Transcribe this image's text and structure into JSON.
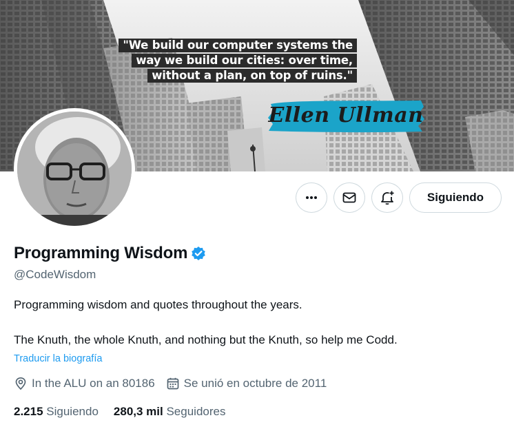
{
  "banner": {
    "quote_lines": [
      "\"We build our computer systems the",
      "way we build our cities: over time,",
      "without a plan, on top of ruins.\""
    ],
    "author": "Ellen Ullman",
    "accent_color": "#1ba4c9"
  },
  "actions": {
    "more_icon": "ellipsis-icon",
    "message_icon": "envelope-icon",
    "notify_icon": "bell-plus-icon",
    "follow_label": "Siguiendo"
  },
  "profile": {
    "display_name": "Programming Wisdom",
    "verified_icon": "verified-badge-icon",
    "verified_color": "#1d9bf0",
    "handle": "@CodeWisdom",
    "bio_line1": "Programming wisdom and quotes throughout the years.",
    "bio_line2": "The Knuth, the whole Knuth, and nothing but the Knuth, so help me Codd.",
    "translate_label": "Traducir la biografía",
    "location": "In the ALU on an 80186",
    "joined": "Se unió en octubre de 2011"
  },
  "stats": {
    "following_count": "2.215",
    "following_label": "Siguiendo",
    "followers_count": "280,3 mil",
    "followers_label": "Seguidores"
  },
  "colors": {
    "text": "#0f1419",
    "secondary": "#536471",
    "link": "#1d9bf0",
    "border": "#cfd9de"
  }
}
